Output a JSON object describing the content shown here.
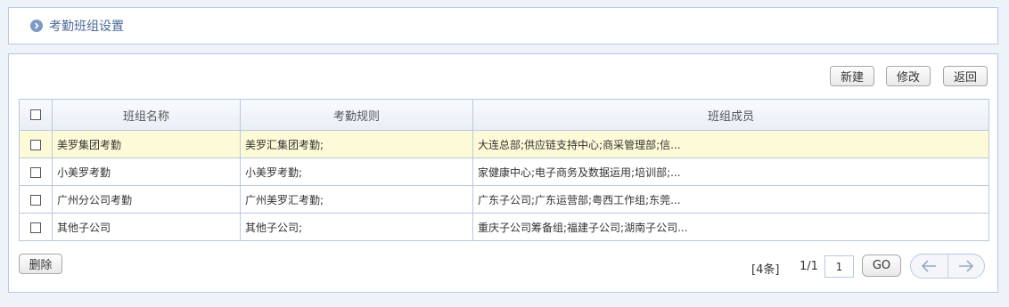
{
  "header": {
    "title": "考勤班组设置"
  },
  "toolbar": {
    "new_label": "新建",
    "edit_label": "修改",
    "back_label": "返回"
  },
  "table": {
    "columns": [
      "班组名称",
      "考勤规则",
      "班组成员"
    ],
    "rows": [
      {
        "name": "美罗集团考勤",
        "rule": "美罗汇集团考勤;",
        "members": "大连总部;供应链支持中心;商采管理部;信..."
      },
      {
        "name": "小美罗考勤",
        "rule": "小美罗考勤;",
        "members": "家健康中心;电子商务及数据运用;培训部;..."
      },
      {
        "name": "广州分公司考勤",
        "rule": "广州美罗汇考勤;",
        "members": "广东子公司;广东运营部;粤西工作组;东莞..."
      },
      {
        "name": "其他子公司",
        "rule": "其他子公司;",
        "members": "重庆子公司筹备组;福建子公司;湖南子公司..."
      }
    ]
  },
  "footer": {
    "delete_label": "删除",
    "count_text": "[4条]",
    "page_text": "1/1",
    "page_input_value": "1",
    "go_label": "GO"
  },
  "icons": {
    "header": "chevron-right-circle-icon",
    "prev": "arrow-left-icon",
    "next": "arrow-right-icon"
  },
  "colors": {
    "accent": "#4a6a9a",
    "border": "#b8c9e0",
    "selected_row": "#fdfbd7",
    "background": "#eef2f9"
  }
}
